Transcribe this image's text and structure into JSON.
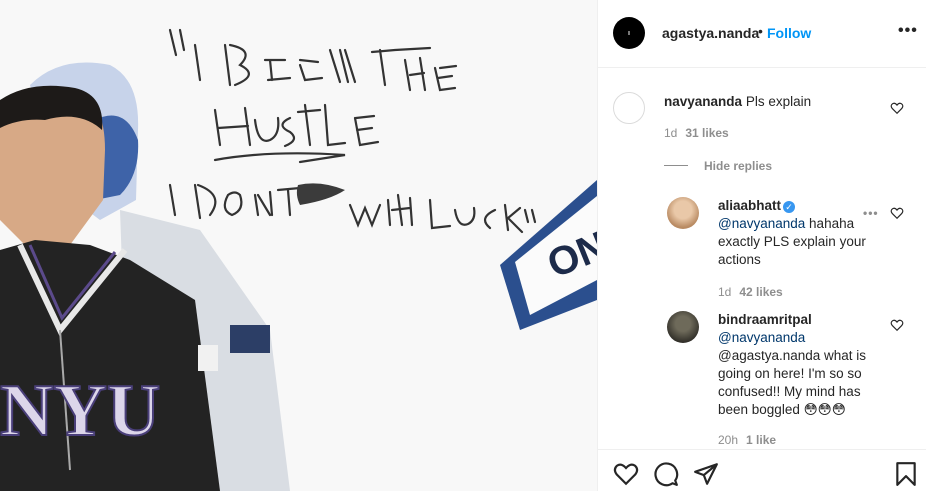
{
  "post": {
    "username": "agastya.nanda",
    "separator": "•",
    "follow_label": "Follow",
    "more_icon": "more-horizontal-icon"
  },
  "comments": [
    {
      "username": "navyananda",
      "text": "Pls explain",
      "time": "1d",
      "likes": "31 likes",
      "avatar_color": "#ffffff",
      "hide_replies_label": "Hide replies"
    },
    {
      "username": "aliaabhatt",
      "verified": true,
      "mention": "@navyananda",
      "lines": [
        "hahaha",
        "exactly PLS explain your",
        "actions"
      ],
      "time": "1d",
      "likes": "42 likes",
      "avatar_color": "#c9a585"
    },
    {
      "username": "bindraamritpal",
      "lines": [
        "@navyananda",
        "@agastya.nanda what is",
        "going on here! I'm so so",
        "confused!! My mind has",
        "been boggled 😳😳😳"
      ],
      "time": "20h",
      "likes": "1 like",
      "avatar_color": "#8a8470"
    }
  ],
  "actions": {
    "like_icon": "heart-icon",
    "comment_icon": "comment-icon",
    "share_icon": "send-icon",
    "save_icon": "bookmark-icon"
  },
  "image": {
    "sign_text": "ON",
    "jacket_text": "NYU",
    "handwriting": [
      "\"I BELIEVE IN THE",
      "HUSTLE",
      "I DONT",
      "WITH LUCK\""
    ]
  },
  "colors": {
    "link": "#0095f6",
    "text": "#262626",
    "muted": "#8e8e8e",
    "border": "#efefef"
  }
}
